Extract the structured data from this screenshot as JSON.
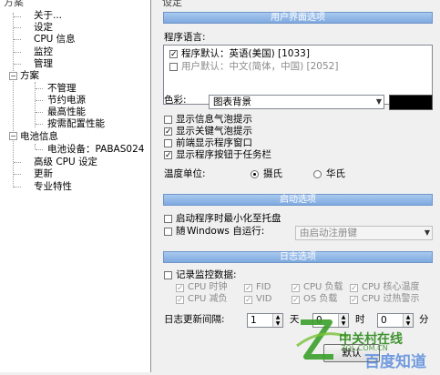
{
  "tree": {
    "header": "方案",
    "items": [
      {
        "label": "关于..."
      },
      {
        "label": "设定"
      },
      {
        "label": "CPU 信息"
      },
      {
        "label": "监控"
      },
      {
        "label": "管理"
      },
      {
        "label": "方案"
      },
      {
        "label": "不管理"
      },
      {
        "label": "节约电源"
      },
      {
        "label": "最高性能"
      },
      {
        "label": "按需配置性能"
      },
      {
        "label": "电池信息"
      },
      {
        "label": "电池设备：PABAS024"
      },
      {
        "label": "高级 CPU 设定"
      },
      {
        "label": "更新"
      },
      {
        "label": "专业特性"
      }
    ]
  },
  "right": {
    "header": "设定",
    "ui_section": "用户界面选项",
    "lang_label": "程序语言:",
    "languages": [
      {
        "label": "程序默认：英语(美国) [1033]",
        "checked": true
      },
      {
        "label": "用户默认：中文(简体，中国) [2052]",
        "checked": false
      }
    ],
    "color_label": "色彩:",
    "color_value": "图表背景",
    "swatch_color": "#000000",
    "options": [
      {
        "label": "显示信息气泡提示",
        "checked": false
      },
      {
        "label": "显示关键气泡提示",
        "checked": true
      },
      {
        "label": "前端显示程序窗口",
        "checked": false
      },
      {
        "label": "显示程序按钮于任务栏",
        "checked": true
      }
    ],
    "temp_label": "温度单位:",
    "temp_celsius": "摄氏",
    "temp_fahrenheit": "华氏",
    "startup_section": "启动选项",
    "startup_minimize": "启动程序时最小化至托盘",
    "startup_with_prefix": "随",
    "startup_with_suffix": "Windows 自运行:",
    "startup_combo": "由启动注册键",
    "log_section": "日志选项",
    "log_record": "记录监控数据:",
    "log_items": [
      {
        "label": "CPU 时钟",
        "checked": true
      },
      {
        "label": "FID",
        "checked": true
      },
      {
        "label": "CPU 负载",
        "checked": true
      },
      {
        "label": "CPU 核心温度",
        "checked": true
      },
      {
        "label": "CPU 减负",
        "checked": true
      },
      {
        "label": "VID",
        "checked": true
      },
      {
        "label": "OS 负载",
        "checked": true
      },
      {
        "label": "CPU 过热警示",
        "checked": true
      }
    ],
    "log_interval_label": "日志更新间隔:",
    "interval_days": "1",
    "unit_day": "天",
    "interval_hours": "0",
    "unit_hour": "时",
    "interval_minutes": "0",
    "unit_minute": "分",
    "default_button": "默认"
  },
  "watermark": {
    "text_top": "中关村在线",
    "text_url": "ZOL.COM.CN",
    "text_bottom": "百度知道"
  }
}
